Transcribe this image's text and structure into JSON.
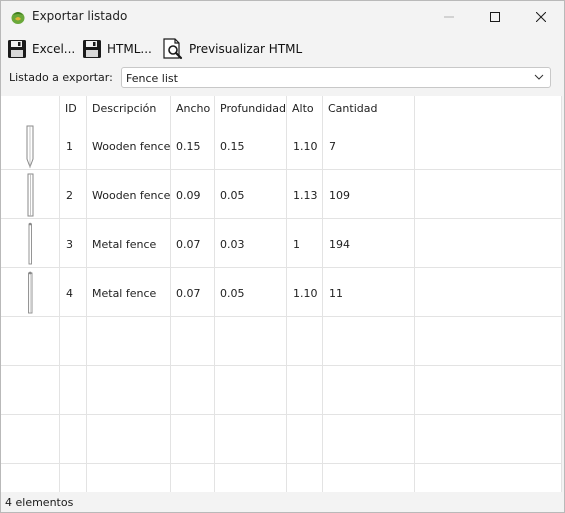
{
  "window": {
    "title": "Exportar listado"
  },
  "toolbar": {
    "excel_label": "Excel...",
    "html_label": "HTML...",
    "preview_label": "Previsualizar HTML"
  },
  "selector": {
    "label": "Listado a exportar:",
    "value": "Fence list"
  },
  "table": {
    "columns": [
      "ID",
      "Descripción",
      "Ancho",
      "Profundidad",
      "Alto",
      "Cantidad"
    ],
    "rows": [
      {
        "id": "1",
        "descripcion": "Wooden fence",
        "ancho": "0.15",
        "profundidad": "0.15",
        "alto": "1.10",
        "cantidad": "7"
      },
      {
        "id": "2",
        "descripcion": "Wooden fence",
        "ancho": "0.09",
        "profundidad": "0.05",
        "alto": "1.13",
        "cantidad": "109"
      },
      {
        "id": "3",
        "descripcion": "Metal fence",
        "ancho": "0.07",
        "profundidad": "0.03",
        "alto": "1",
        "cantidad": "194"
      },
      {
        "id": "4",
        "descripcion": "Metal fence",
        "ancho": "0.07",
        "profundidad": "0.05",
        "alto": "1.10",
        "cantidad": "11"
      }
    ]
  },
  "status": {
    "text": "4 elementos"
  },
  "icons": {
    "app": "app-icon",
    "save": "floppy-disk-icon",
    "preview": "magnifier-document-icon",
    "dropdown": "chevron-down-icon"
  }
}
